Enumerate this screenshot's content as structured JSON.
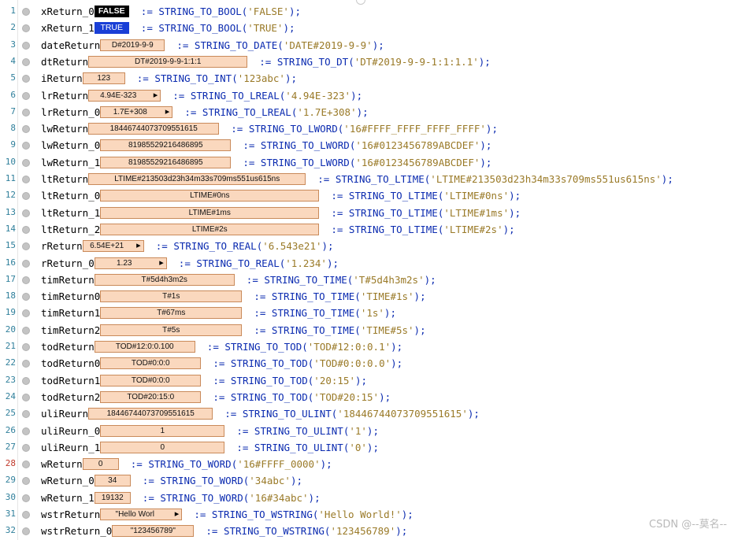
{
  "watermark": "CSDN @--莫名--",
  "lines": [
    {
      "num": "1",
      "var": "xReturn_0",
      "val": "FALSE",
      "kind": "false",
      "w": 44,
      "gap": "  ",
      "fn": "STRING_TO_BOOL",
      "arg": "'FALSE'"
    },
    {
      "num": "2",
      "var": "xReturn_1",
      "val": "TRUE",
      "kind": "true",
      "w": 44,
      "gap": "  ",
      "fn": "STRING_TO_BOOL",
      "arg": "'TRUE'"
    },
    {
      "num": "3",
      "var": "dateReturn",
      "val": "D#2019-9-9",
      "kind": "",
      "w": 82,
      "gap": "  ",
      "fn": "STRING_TO_DATE",
      "arg": "'DATE#2019-9-9'"
    },
    {
      "num": "4",
      "var": "dtReturn",
      "val": "DT#2019-9-9-1:1:1",
      "kind": "",
      "w": 202,
      "gap": "  ",
      "fn": "STRING_TO_DT",
      "arg": "'DT#2019-9-9-1:1:1.1'"
    },
    {
      "num": "5",
      "var": "iReturn",
      "val": "123",
      "kind": "",
      "w": 54,
      "gap": "  ",
      "fn": "STRING_TO_INT",
      "arg": "'123abc'"
    },
    {
      "num": "6",
      "var": "lrReturn",
      "val": "4.94E-323",
      "kind": "arrow",
      "w": 92,
      "gap": "  ",
      "fn": "STRING_TO_LREAL",
      "arg": "'4.94E-323'"
    },
    {
      "num": "7",
      "var": "lrReturn_0",
      "val": "1.7E+308",
      "kind": "arrow",
      "w": 92,
      "gap": "  ",
      "fn": "STRING_TO_LREAL",
      "arg": "'1.7E+308'"
    },
    {
      "num": "8",
      "var": "lwReturn",
      "val": "18446744073709551615",
      "kind": "",
      "w": 166,
      "gap": "  ",
      "fn": "STRING_TO_LWORD",
      "arg": "'16#FFFF_FFFF_FFFF_FFFF'"
    },
    {
      "num": "9",
      "var": "lwReturn_0",
      "val": "81985529216486895",
      "kind": "",
      "w": 166,
      "gap": "  ",
      "fn": "STRING_TO_LWORD",
      "arg": "'16#0123456789ABCDEF'"
    },
    {
      "num": "10",
      "var": "lwReturn_1",
      "val": "81985529216486895",
      "kind": "",
      "w": 166,
      "gap": "  ",
      "fn": "STRING_TO_LWORD",
      "arg": "'16#0123456789ABCDEF'"
    },
    {
      "num": "11",
      "var": "ltReturn",
      "val": "LTIME#213503d23h34m33s709ms551us615ns",
      "kind": "",
      "w": 276,
      "gap": "  ",
      "fn": "STRING_TO_LTIME",
      "arg": "'LTIME#213503d23h34m33s709ms551us615ns'"
    },
    {
      "num": "12",
      "var": "ltReturn_0",
      "val": "LTIME#0ns",
      "kind": "",
      "w": 278,
      "gap": "  ",
      "fn": "STRING_TO_LTIME",
      "arg": "'LTIME#0ns'"
    },
    {
      "num": "13",
      "var": "ltReturn_1",
      "val": "LTIME#1ms",
      "kind": "",
      "w": 278,
      "gap": "  ",
      "fn": "STRING_TO_LTIME",
      "arg": "'LTIME#1ms'"
    },
    {
      "num": "14",
      "var": "ltReturn_2",
      "val": "LTIME#2s",
      "kind": "",
      "w": 278,
      "gap": "  ",
      "fn": "STRING_TO_LTIME",
      "arg": "'LTIME#2s'"
    },
    {
      "num": "15",
      "var": "rReturn",
      "val": "6.54E+21",
      "kind": "arrow",
      "w": 78,
      "gap": "  ",
      "fn": "STRING_TO_REAL",
      "arg": "'6.543e21'"
    },
    {
      "num": "16",
      "var": "rReturn_0",
      "val": "1.23",
      "kind": "arrow",
      "w": 92,
      "gap": "  ",
      "fn": "STRING_TO_REAL",
      "arg": "'1.234'"
    },
    {
      "num": "17",
      "var": "timReturn",
      "val": "T#5d4h3m2s",
      "kind": "",
      "w": 178,
      "gap": "  ",
      "fn": "STRING_TO_TIME",
      "arg": "'T#5d4h3m2s'"
    },
    {
      "num": "18",
      "var": "timReturn0",
      "val": "T#1s",
      "kind": "",
      "w": 180,
      "gap": "  ",
      "fn": "STRING_TO_TIME",
      "arg": "'TIME#1s'"
    },
    {
      "num": "19",
      "var": "timReturn1",
      "val": "T#67ms",
      "kind": "",
      "w": 180,
      "gap": "  ",
      "fn": "STRING_TO_TIME",
      "arg": "'1s'"
    },
    {
      "num": "20",
      "var": "timReturn2",
      "val": "T#5s",
      "kind": "",
      "w": 180,
      "gap": "  ",
      "fn": "STRING_TO_TIME",
      "arg": "'TIME#5s'"
    },
    {
      "num": "21",
      "var": "todReturn",
      "val": "TOD#12:0:0.100",
      "kind": "",
      "w": 128,
      "gap": "  ",
      "fn": "STRING_TO_TOD",
      "arg": "'TOD#12:0:0.1'"
    },
    {
      "num": "22",
      "var": "todReturn0",
      "val": "TOD#0:0:0",
      "kind": "",
      "w": 128,
      "gap": "  ",
      "fn": "STRING_TO_TOD",
      "arg": "'TOD#0:0:0.0'"
    },
    {
      "num": "23",
      "var": "todReturn1",
      "val": "TOD#0:0:0",
      "kind": "",
      "w": 128,
      "gap": "  ",
      "fn": "STRING_TO_TOD",
      "arg": "'20:15'"
    },
    {
      "num": "24",
      "var": "todReturn2",
      "val": "TOD#20:15:0",
      "kind": "",
      "w": 128,
      "gap": "  ",
      "fn": "STRING_TO_TOD",
      "arg": "'TOD#20:15'"
    },
    {
      "num": "25",
      "var": "uliReurn",
      "val": "18446744073709551615",
      "kind": "",
      "w": 158,
      "gap": "  ",
      "fn": "STRING_TO_ULINT",
      "arg": "'18446744073709551615'"
    },
    {
      "num": "26",
      "var": "uliReurn_0",
      "val": "1",
      "kind": "",
      "w": 158,
      "gap": "  ",
      "fn": "STRING_TO_ULINT",
      "arg": "'1'"
    },
    {
      "num": "27",
      "var": "uliReurn_1",
      "val": "0",
      "kind": "",
      "w": 158,
      "gap": "  ",
      "fn": "STRING_TO_ULINT",
      "arg": "'0'"
    },
    {
      "num": "28",
      "var": "wReturn",
      "val": "0",
      "kind": "",
      "w": 46,
      "gap": "  ",
      "fn": "STRING_TO_WORD",
      "arg": "'16#FFFF_0000'",
      "red": true
    },
    {
      "num": "29",
      "var": "wReturn_0",
      "val": "34",
      "kind": "",
      "w": 46,
      "gap": "  ",
      "fn": "STRING_TO_WORD",
      "arg": "'34abc'"
    },
    {
      "num": "30",
      "var": "wReturn_1",
      "val": "19132",
      "kind": "",
      "w": 46,
      "gap": "  ",
      "fn": "STRING_TO_WORD",
      "arg": "'16#34abc'"
    },
    {
      "num": "31",
      "var": "wstrReturn",
      "val": "\"Hello Worl",
      "kind": "arrow",
      "w": 104,
      "gap": "  ",
      "fn": "STRING_TO_WSTRING",
      "arg": "'Hello World!'"
    },
    {
      "num": "32",
      "var": "wstrReturn_0",
      "val": "\"123456789\"",
      "kind": "",
      "w": 104,
      "gap": "  ",
      "fn": "STRING_TO_WSTRING",
      "arg": "'123456789'"
    }
  ],
  "tokens": {
    "assign": ":=",
    "open": "(",
    "close": ");"
  }
}
